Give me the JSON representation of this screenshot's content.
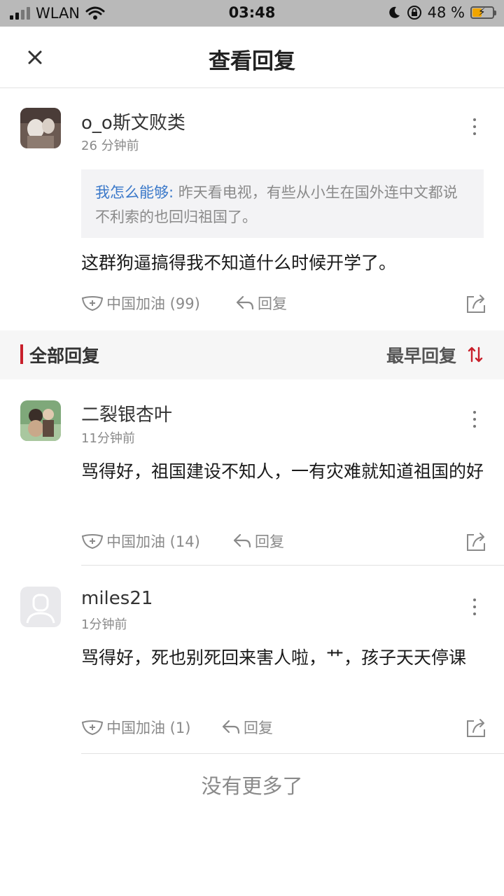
{
  "status_bar": {
    "carrier": "WLAN",
    "time": "03:48",
    "battery_percent": "48 %",
    "battery_level": 0.48
  },
  "header": {
    "title": "查看回复",
    "close_icon": "close-icon"
  },
  "main_comment": {
    "username": "o_o斯文败类",
    "time": "26 分钟前",
    "quote_author": "我怎么能够:",
    "quote_text": " 昨天看电视，有些从小生在国外连中文都说不利索的也回归祖国了。",
    "text": "这群狗逼搞得我不知道什么时候开学了。",
    "like_label": "中国加油 (99)",
    "reply_label": "回复"
  },
  "section": {
    "title": "全部回复",
    "sort_label": "最早回复",
    "accent_color": "#c8202b"
  },
  "replies": [
    {
      "username": "二裂银杏叶",
      "time": "11分钟前",
      "text": "骂得好，祖国建设不知人，一有灾难就知道祖国的好",
      "like_label": "中国加油 (14)",
      "reply_label": "回复"
    },
    {
      "username": "miles21",
      "time": "1分钟前",
      "text": "骂得好，死也别死回来害人啦，艹，孩子天天停课",
      "like_label": "中国加油 (1)",
      "reply_label": "回复"
    }
  ],
  "footer": {
    "no_more_text": "没有更多了"
  }
}
